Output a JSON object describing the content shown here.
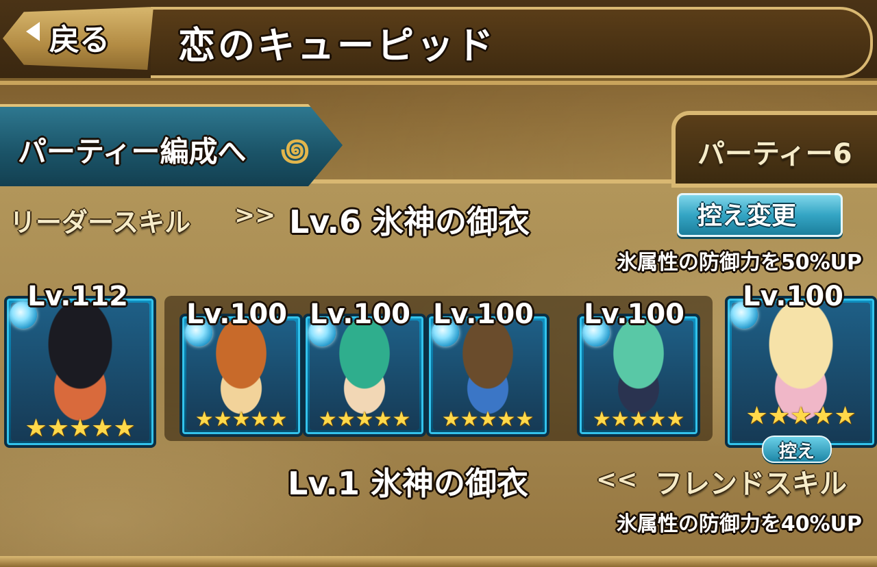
{
  "header": {
    "back_label": "戻る",
    "title": "恋のキューピッド"
  },
  "party_edit": {
    "label": "パーティー編成へ"
  },
  "party_tab": {
    "label": "パーティー6"
  },
  "leader": {
    "label": "リーダースキル",
    "arrows": ">>",
    "skill": "Lv.6 氷神の御衣",
    "description": "氷属性の防御力を50%UP"
  },
  "reserve_button": {
    "label": "控え変更"
  },
  "team": [
    {
      "level": "Lv.112",
      "stars": 5,
      "role": "leader",
      "colors": [
        "#1b1b22",
        "#d96a3c"
      ]
    },
    {
      "level": "Lv.100",
      "stars": 5,
      "role": "member",
      "colors": [
        "#c86a2a",
        "#f2d39a"
      ]
    },
    {
      "level": "Lv.100",
      "stars": 5,
      "role": "member",
      "colors": [
        "#2fae8d",
        "#f2d7b5"
      ]
    },
    {
      "level": "Lv.100",
      "stars": 5,
      "role": "member",
      "colors": [
        "#6a4c2c",
        "#3b76c6"
      ]
    },
    {
      "level": "Lv.100",
      "stars": 5,
      "role": "member",
      "colors": [
        "#59c8a6",
        "#2a3350"
      ]
    },
    {
      "level": "Lv.100",
      "stars": 5,
      "role": "friend",
      "colors": [
        "#f6e2a8",
        "#f0b7c8"
      ]
    }
  ],
  "reserve_badge": "控え",
  "friend": {
    "skill": "Lv.1 氷神の御衣",
    "arrows": "<<",
    "label": "フレンドスキル",
    "description": "氷属性の防御力を40%UP"
  },
  "colors": {
    "accent_gold": "#d9b872",
    "accent_teal": "#1b5468",
    "card_blue": "#0a6a94"
  }
}
